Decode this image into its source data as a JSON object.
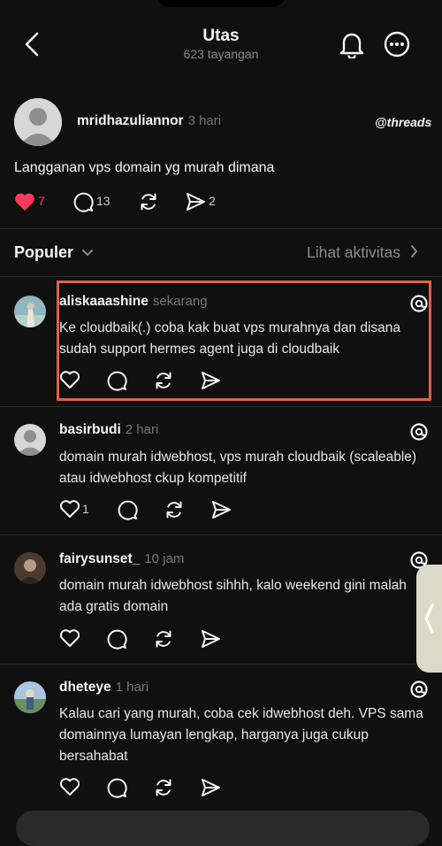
{
  "header": {
    "title": "Utas",
    "views": "623 tayangan"
  },
  "post": {
    "author": "mridhazuliannor",
    "time": "3 hari",
    "brand": "threads",
    "text": "Langganan vps domain yg murah dimana",
    "likes": "7",
    "comments": "13",
    "shares": "2",
    "like_color": "#fe3b57"
  },
  "sort": {
    "label": "Populer",
    "activity_link": "Lihat aktivitas"
  },
  "replies": [
    {
      "author": "aliskaaashine",
      "time": "sekarang",
      "text": "Ke cloudbaik(.) coba kak buat vps murahnya dan disana sudah support hermes agent juga di cloudbaik",
      "likes": ""
    },
    {
      "author": "basirbudi",
      "time": "2 hari",
      "text": "domain murah idwebhost, vps murah cloudbaik (scaleable) atau idwebhost ckup kompetitif",
      "likes": "1"
    },
    {
      "author": "fairysunset_",
      "time": "10 jam",
      "text": "domain murah idwebhost sihhh, kalo weekend gini malah ada gratis domain",
      "likes": ""
    },
    {
      "author": "dheteye",
      "time": "1 hari",
      "text": "Kalau cari yang murah, coba cek idwebhost deh. VPS sama domainnya lumayan lengkap, harganya juga cukup bersahabat",
      "likes": ""
    }
  ],
  "colors": {
    "background": "#101010",
    "highlight_border": "#e0614a",
    "muted_text": "#777777"
  }
}
